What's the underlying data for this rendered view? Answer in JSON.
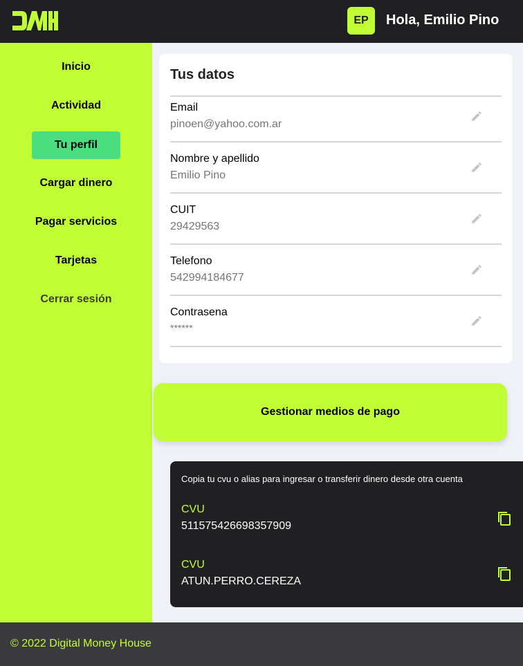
{
  "header": {
    "logo_text": "DMH",
    "avatar_initials": "EP",
    "greeting": "Hola, Emilio Pino"
  },
  "sidebar": {
    "items": [
      {
        "label": "Inicio",
        "active": false
      },
      {
        "label": "Actividad",
        "active": false
      },
      {
        "label": "Tu perfil",
        "active": true
      },
      {
        "label": "Cargar dinero",
        "active": false
      },
      {
        "label": "Pagar servicios",
        "active": false
      },
      {
        "label": "Tarjetas",
        "active": false
      },
      {
        "label": "Cerrar sesión",
        "active": false
      }
    ]
  },
  "profile": {
    "title": "Tus datos",
    "fields": [
      {
        "label": "Email",
        "value": "pinoen@yahoo.com.ar",
        "icon": "pencil-icon"
      },
      {
        "label": "Nombre y apellido",
        "value": "Emilio Pino",
        "icon": "pencil-icon"
      },
      {
        "label": "CUIT",
        "value": "29429563",
        "icon": "pencil-icon"
      },
      {
        "label": "Telefono",
        "value": "542994184677",
        "icon": "pencil-icon"
      },
      {
        "label": "Contrasena",
        "value": "******",
        "icon": "pencil-icon"
      }
    ]
  },
  "payment_button": {
    "label": "Gestionar medios de pago"
  },
  "cvu_panel": {
    "note": "Copia tu cvu o alias para ingresar o transferir dinero desde otra cuenta",
    "entries": [
      {
        "label": "CVU",
        "value": "511575426698357909",
        "icon": "copy-icon"
      },
      {
        "label": "CVU",
        "value": "ATUN.PERRO.CEREZA",
        "icon": "copy-icon"
      }
    ]
  },
  "footer": {
    "text": "© 2022 Digital Money House"
  },
  "colors": {
    "accent": "#c1fd35",
    "dark": "#201f22",
    "active_nav": "#4ade80",
    "footer_bg": "#3a393e"
  }
}
